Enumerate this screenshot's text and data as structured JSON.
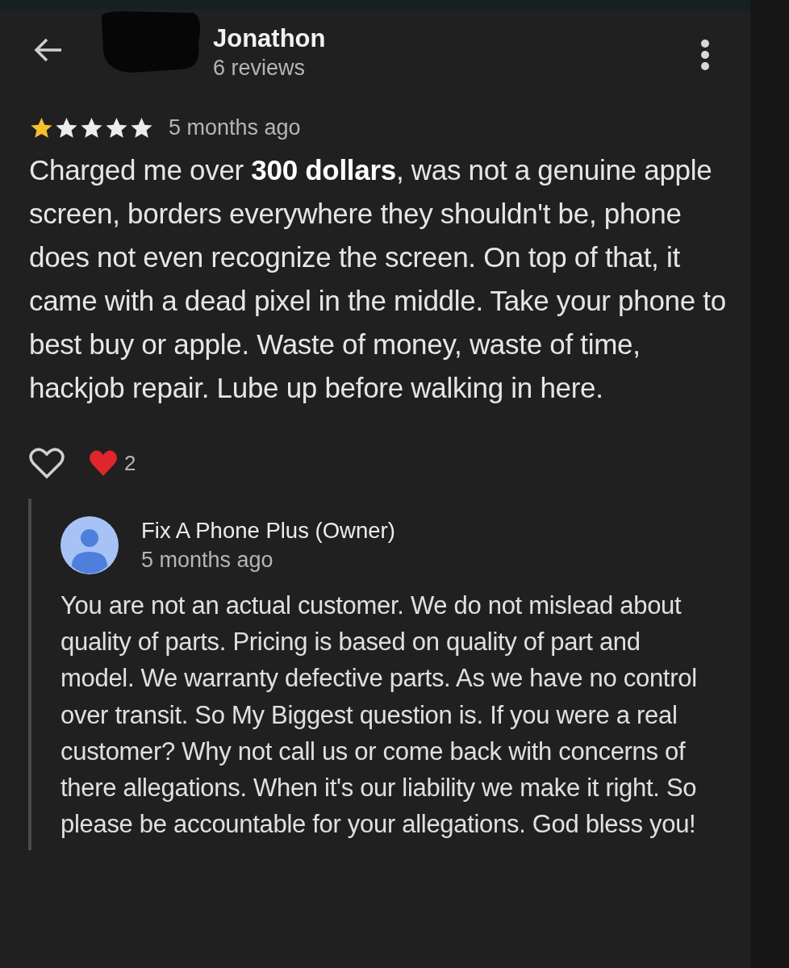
{
  "reviewer": {
    "name": "Jonathon",
    "review_count": "6 reviews"
  },
  "review": {
    "stars": 1,
    "time": "5 months ago",
    "text": "Charged me over **300 dollars**, was not a genuine apple screen, borders everywhere they shouldn't be, phone does not even recognize the screen. On top of that, it came with a dead pixel in the middle. Take your phone to best buy or apple. Waste of money, waste of time, hackjob repair. Lube up before walking in here."
  },
  "reactions": {
    "liked": false,
    "count": "2"
  },
  "owner_reply": {
    "name": "Fix A Phone Plus (Owner)",
    "time": "5 months ago",
    "text": "You are not an actual customer. We do not mislead about quality of parts. Pricing is based on quality of part and model. We warranty defective parts. As we have no control over transit. So My Biggest question is. If you were a real customer? Why not call us or come back with concerns of there allegations. When it's our liability we make it right. So please be accountable for your allegations. God bless you!"
  }
}
